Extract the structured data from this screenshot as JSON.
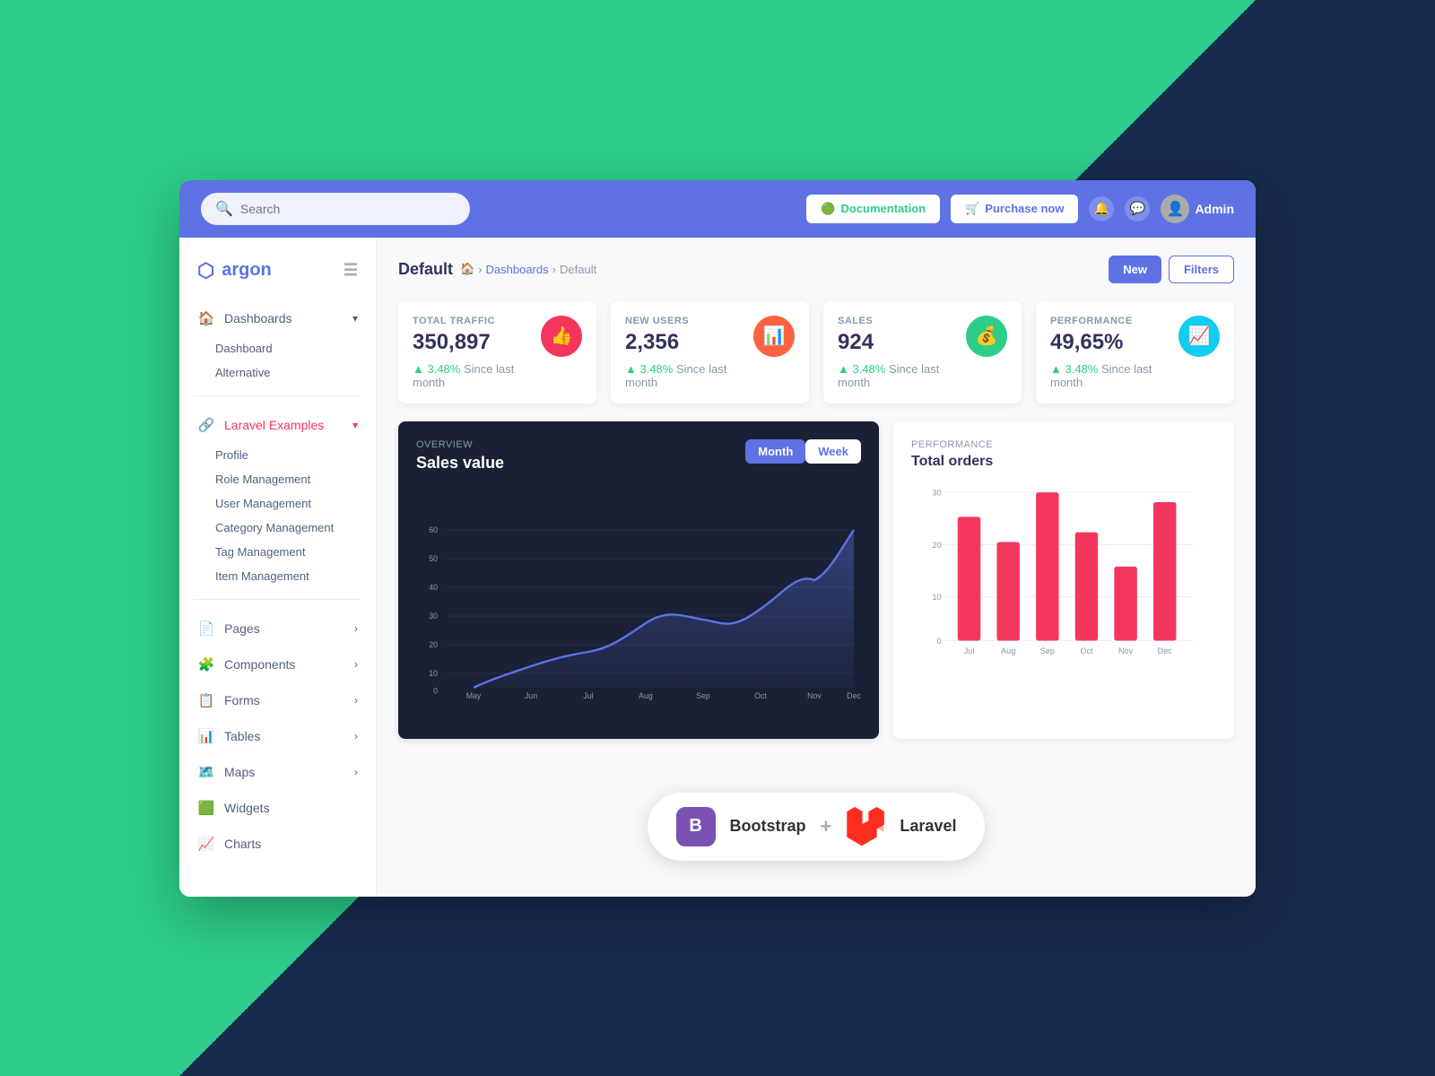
{
  "header": {
    "search_placeholder": "Search",
    "doc_btn": "Documentation",
    "purchase_btn": "Purchase now",
    "admin_label": "Admin",
    "notification_icon": "bell",
    "messages_icon": "comment"
  },
  "sidebar": {
    "logo": "argon",
    "sections": [
      {
        "items": [
          {
            "id": "dashboards",
            "label": "Dashboards",
            "icon": "🏠",
            "has_chevron": true,
            "expanded": true
          },
          {
            "id": "dashboard",
            "label": "Dashboard",
            "sub": true
          },
          {
            "id": "alternative",
            "label": "Alternative",
            "sub": true
          }
        ]
      },
      {
        "items": [
          {
            "id": "laravel-examples",
            "label": "Laravel Examples",
            "icon": "🔗",
            "has_chevron": true,
            "expanded": true,
            "red": true
          },
          {
            "id": "profile",
            "label": "Profile",
            "sub": true
          },
          {
            "id": "role-management",
            "label": "Role Management",
            "sub": true
          },
          {
            "id": "user-management",
            "label": "User Management",
            "sub": true
          },
          {
            "id": "category-management",
            "label": "Category Management",
            "sub": true
          },
          {
            "id": "tag-management",
            "label": "Tag Management",
            "sub": true
          },
          {
            "id": "item-management",
            "label": "Item Management",
            "sub": true
          }
        ]
      },
      {
        "items": [
          {
            "id": "pages",
            "label": "Pages",
            "icon": "📄",
            "has_chevron": true
          },
          {
            "id": "components",
            "label": "Components",
            "icon": "🧩",
            "has_chevron": true
          },
          {
            "id": "forms",
            "label": "Forms",
            "icon": "📋",
            "has_chevron": true
          },
          {
            "id": "tables",
            "label": "Tables",
            "icon": "📊",
            "has_chevron": true
          },
          {
            "id": "maps",
            "label": "Maps",
            "icon": "🗺️",
            "has_chevron": true
          },
          {
            "id": "widgets",
            "label": "Widgets",
            "icon": "🟩"
          },
          {
            "id": "charts",
            "label": "Charts",
            "icon": "📈"
          }
        ]
      }
    ]
  },
  "breadcrumb": {
    "title": "Default",
    "home_icon": "🏠",
    "items": [
      "Dashboards",
      "Default"
    ],
    "new_btn": "New",
    "filters_btn": "Filters"
  },
  "stats": [
    {
      "id": "total-traffic",
      "label": "TOTAL TRAFFIC",
      "value": "350,897",
      "change": "▲ 3.48%",
      "change_text": "Since last month",
      "icon_color": "#f5365c",
      "icon": "👍"
    },
    {
      "id": "new-users",
      "label": "NEW USERS",
      "value": "2,356",
      "change": "▲ 3.48%",
      "change_text": "Since last month",
      "icon_color": "#fb6340",
      "icon": "📊"
    },
    {
      "id": "sales",
      "label": "SALES",
      "value": "924",
      "change": "▲ 3.48%",
      "change_text": "Since last month",
      "icon_color": "#2dce89",
      "icon": "💰"
    },
    {
      "id": "performance",
      "label": "PERFORMANCE",
      "value": "49,65%",
      "change": "▲ 3.48%",
      "change_text": "Since last month",
      "icon_color": "#11cdef",
      "icon": "📈"
    }
  ],
  "sales_chart": {
    "section_label": "OVERVIEW",
    "title": "Sales value",
    "month_btn": "Month",
    "week_btn": "Week",
    "months": [
      "May",
      "Jun",
      "Jul",
      "Aug",
      "Sep",
      "Oct",
      "Nov",
      "Dec"
    ],
    "y_labels": [
      "0",
      "10",
      "20",
      "30",
      "40",
      "50",
      "60"
    ]
  },
  "orders_chart": {
    "section_label": "PERFORMANCE",
    "title": "Total orders",
    "months": [
      "Jul",
      "Aug",
      "Sep",
      "Oct",
      "Nov",
      "Dec"
    ],
    "values": [
      25,
      20,
      30,
      22,
      15,
      28
    ],
    "y_labels": [
      "0",
      "10",
      "20",
      "30"
    ]
  },
  "bottom": {
    "bootstrap_label": "Bootstrap",
    "plus": "+",
    "laravel_label": "Laravel"
  }
}
